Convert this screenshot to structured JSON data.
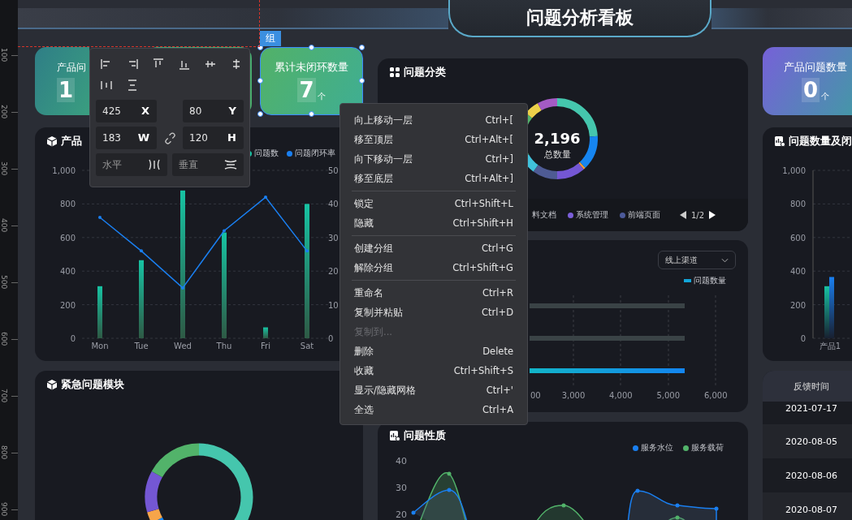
{
  "ruler": {
    "marks": [
      "100",
      "200",
      "300",
      "400",
      "500",
      "600",
      "700",
      "800",
      "900"
    ]
  },
  "header": {
    "title": "问题分析看板"
  },
  "group_tag": "组",
  "stat_cards": [
    {
      "label": "产品问",
      "value": "1",
      "selected": false
    },
    {
      "selected": false
    },
    {
      "label": "累计未闭环数量",
      "value": "7",
      "unit": "个",
      "selected": true
    }
  ],
  "left_chart": {
    "title": "产品",
    "chart_data": {
      "type": "bar",
      "categories": [
        "Mon",
        "Tue",
        "Wed",
        "Thu",
        "Fri",
        "Sat"
      ],
      "series": [
        {
          "name": "问题数",
          "color": "#17c3a3",
          "values": [
            310,
            465,
            880,
            630,
            65,
            800
          ]
        },
        {
          "name": "问题闭环率",
          "color": "#1a7ff0",
          "type": "line",
          "axis": "y2",
          "values": [
            36,
            26,
            15,
            32,
            42,
            26
          ]
        }
      ],
      "ylim": [
        0,
        1000
      ],
      "yticks": [
        0,
        200,
        400,
        600,
        800,
        {
          "value": 1000,
          "label": "1,000"
        }
      ],
      "y2lim": [
        0,
        50
      ],
      "y2ticks": [
        0,
        10,
        20,
        30,
        40,
        50
      ],
      "grid": true
    }
  },
  "urgent_panel": {
    "title": "紧急问题模块"
  },
  "category_panel": {
    "title": "问题分类",
    "total": "2,196",
    "total_label": "总数量",
    "legend": [
      {
        "label": "料文档"
      },
      {
        "label": "系统管理",
        "color": "#7b5fd9"
      },
      {
        "label": "前端页面",
        "color": "#4c5a9a"
      }
    ],
    "page": "1/2"
  },
  "channel_panel": {
    "dropdown": "线上渠道",
    "legend": "问题数量",
    "axis_labels": [
      "00",
      "3,000",
      "4,000",
      "5,000",
      "6,000"
    ]
  },
  "nature_panel": {
    "title": "问题性质",
    "legend": [
      {
        "label": "服务水位",
        "color": "#1a7ff0"
      },
      {
        "label": "服务载荷",
        "color": "#52b36a"
      }
    ],
    "axis_labels": [
      "40",
      "30",
      "20"
    ]
  },
  "right_stat_card": {
    "label": "产品问题数量",
    "value": "0",
    "unit": "个",
    "selected": false
  },
  "right_chart": {
    "title": "问题数量及闭",
    "chart_data": {
      "type": "bar",
      "categories": [
        "产品1"
      ],
      "series": [
        {
          "color": "#17c3a3",
          "values": [
            310
          ]
        },
        {
          "color": "#1a7ff0",
          "values": [
            365
          ]
        }
      ],
      "ylim": [
        0,
        1000
      ],
      "yticks": [
        0,
        200,
        400,
        600,
        800,
        {
          "value": 1000,
          "label": "1,000"
        }
      ],
      "grid": true
    }
  },
  "table": {
    "columns": [
      "反馈时间"
    ],
    "rows": [
      [
        "2021-07-17"
      ],
      [
        "2020-08-05"
      ],
      [
        "2020-08-06"
      ],
      [
        "2020-08-07"
      ]
    ]
  },
  "toolbar": {
    "fields": [
      {
        "label": "X",
        "value": "425"
      },
      {
        "label": "Y",
        "value": "80"
      },
      {
        "label": "W",
        "value": "183"
      },
      {
        "label": "H",
        "value": "120"
      }
    ],
    "spacing": [
      {
        "placeholder": "水平"
      },
      {
        "placeholder": "垂直"
      }
    ]
  },
  "context_menu": {
    "groups": [
      [
        {
          "label": "向上移动一层",
          "shortcut": "Ctrl+[",
          "disabled": false
        },
        {
          "label": "移至顶层",
          "shortcut": "Ctrl+Alt+[",
          "disabled": false
        },
        {
          "label": "向下移动一层",
          "shortcut": "Ctrl+]",
          "disabled": false
        },
        {
          "label": "移至底层",
          "shortcut": "Ctrl+Alt+]",
          "disabled": false
        }
      ],
      [
        {
          "label": "锁定",
          "shortcut": "Ctrl+Shift+L",
          "disabled": false
        },
        {
          "label": "隐藏",
          "shortcut": "Ctrl+Shift+H",
          "disabled": false
        }
      ],
      [
        {
          "label": "创建分组",
          "shortcut": "Ctrl+G",
          "disabled": false
        },
        {
          "label": "解除分组",
          "shortcut": "Ctrl+Shift+G",
          "disabled": false
        }
      ],
      [
        {
          "label": "重命名",
          "shortcut": "Ctrl+R",
          "disabled": false
        },
        {
          "label": "复制并粘贴",
          "shortcut": "Ctrl+D",
          "disabled": false
        },
        {
          "label": "复制到...",
          "disabled": true
        },
        {
          "label": "删除",
          "shortcut": "Delete",
          "disabled": false
        },
        {
          "label": "收藏",
          "shortcut": "Ctrl+Shift+S",
          "disabled": false
        },
        {
          "label": "显示/隐藏网格",
          "shortcut": "Ctrl+'",
          "disabled": false
        },
        {
          "label": "全选",
          "shortcut": "Ctrl+A",
          "disabled": false
        }
      ]
    ]
  }
}
